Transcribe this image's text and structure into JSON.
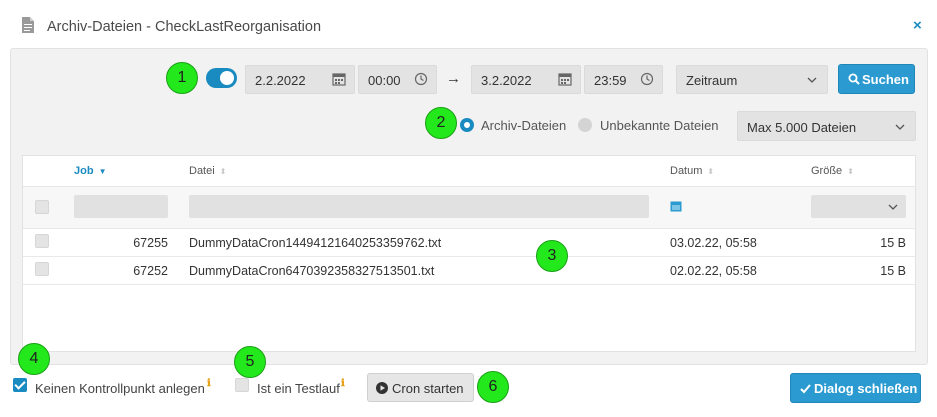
{
  "window": {
    "title": "Archiv-Dateien - CheckLastReorganisation",
    "close_glyph": "×"
  },
  "search": {
    "from_date": "2.2.2022",
    "from_time": "00:00",
    "arrow": "→",
    "to_date": "3.2.2022",
    "to_time": "23:59",
    "period_select": "Zeitraum",
    "search_button": "Suchen",
    "toggle_on": true
  },
  "filter": {
    "radio_archive": "Archiv-Dateien",
    "radio_unknown": "Unbekannte Dateien",
    "selected": "Archiv-Dateien",
    "max_select": "Max 5.000 Dateien"
  },
  "table": {
    "columns": {
      "job": "Job",
      "file": "Datei",
      "date": "Datum",
      "size": "Größe"
    },
    "rows": [
      {
        "job": "67255",
        "file": "DummyDataCron14494121640253359762.txt",
        "date": "03.02.22, 05:58",
        "size": "15 B"
      },
      {
        "job": "67252",
        "file": "DummyDataCron6470392358327513501.txt",
        "date": "02.02.22, 05:58",
        "size": "15 B"
      }
    ]
  },
  "footer": {
    "no_checkpoint_label": "Keinen Kontrollpunkt anlegen",
    "no_checkpoint_checked": true,
    "testrun_label": "Ist ein Testlauf",
    "testrun_checked": false,
    "info_glyph": "ℹ",
    "cron_button": "Cron starten",
    "close_dialog_button": "Dialog schließen"
  },
  "annotations": [
    "1",
    "2",
    "3",
    "4",
    "5",
    "6"
  ],
  "colors": {
    "accent": "#1a8bc0",
    "badge": "#22e81c",
    "info": "#e8a21a"
  }
}
